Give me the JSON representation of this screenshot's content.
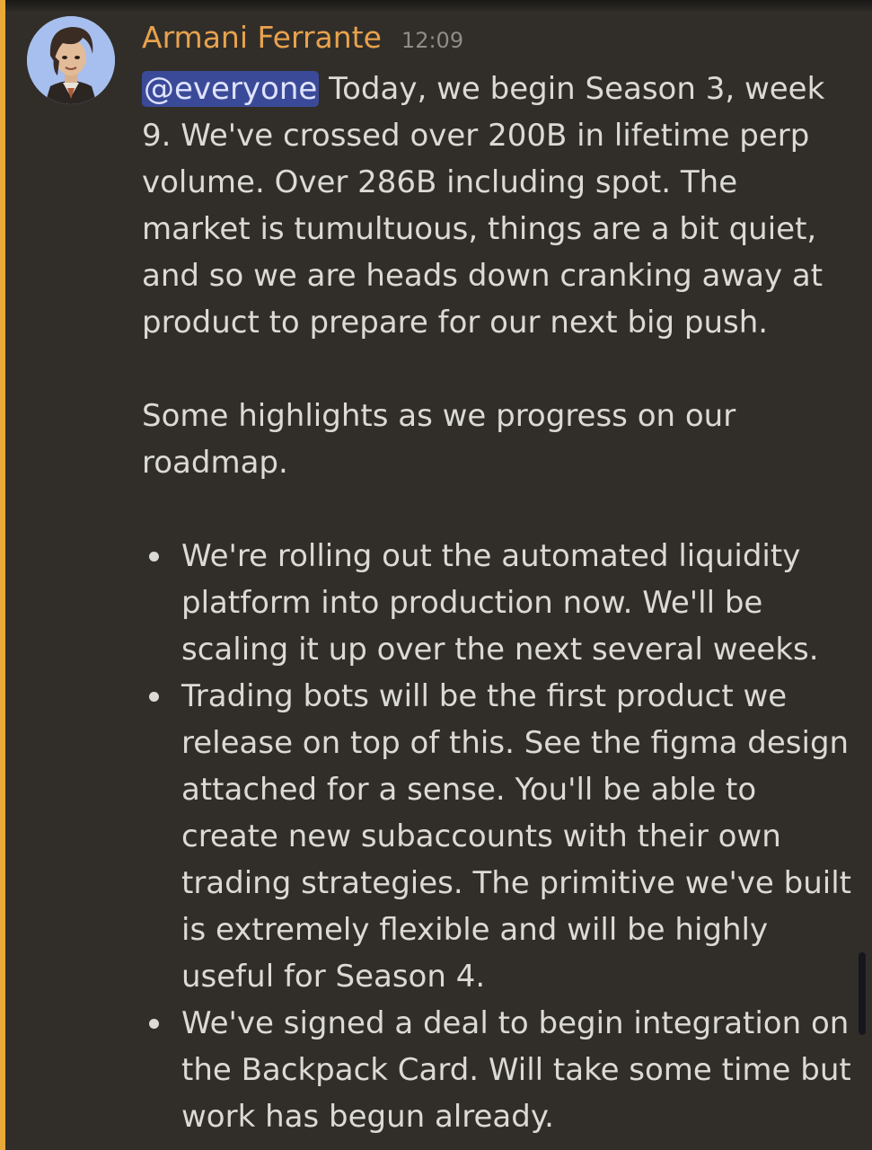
{
  "message": {
    "author": "Armani Ferrante",
    "timestamp": "12:09",
    "mention": "@everyone",
    "intro": " Today, we begin Season 3, week 9. We've crossed over 200B in lifetime perp volume. Over 286B including spot. The market is tumultuous, things are a bit quiet, and so we are heads down cranking away at product to prepare for our next big push.",
    "highlights_intro": "Some highlights as we progress on our roadmap.",
    "bullets": [
      "We're rolling out the automated liquidity platform into production now. We'll be scaling it up over the next several weeks.",
      "Trading bots will be the first product we release on top of this. See the figma design attached for a sense. You'll be able to create new subaccounts with their own trading strategies. The primitive we've built is extremely flexible and will be highly useful for Season 4.",
      "We've signed a deal to begin integration on the Backpack Card. Will take some time but work has begun already."
    ]
  },
  "colors": {
    "background": "#312e2a",
    "mention_highlight_bar": "#e8a93a",
    "username": "#e8a24c",
    "mention_background": "#3b4a98"
  },
  "icons": {
    "avatar": "user-avatar-anime-portrait"
  }
}
